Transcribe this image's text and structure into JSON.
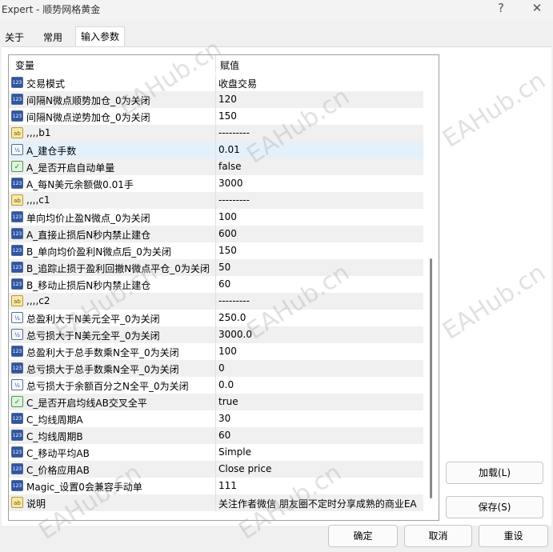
{
  "window": {
    "title": "Expert - 顺势网格黄金",
    "help_label": "?",
    "close_label": "✕"
  },
  "tabs": [
    {
      "label": "关于"
    },
    {
      "label": "常用"
    },
    {
      "label": "输入参数"
    }
  ],
  "grid": {
    "col_name": "变量",
    "col_value": "赋值",
    "rows": [
      {
        "type": "int",
        "name": "交易模式",
        "value": "收盘交易"
      },
      {
        "type": "int",
        "name": "间隔N微点顺势加仓_0为关闭",
        "value": "120"
      },
      {
        "type": "int",
        "name": "间隔N微点逆势加仓_0为关闭",
        "value": "150"
      },
      {
        "type": "ab",
        "name": ",,,,b1",
        "value": "---------"
      },
      {
        "type": "dbl",
        "name": "A_建仓手数",
        "value": "0.01"
      },
      {
        "type": "bool",
        "name": "A_是否开启自动单量",
        "value": "false"
      },
      {
        "type": "int",
        "name": "A_每N美元余额做0.01手",
        "value": "3000"
      },
      {
        "type": "ab",
        "name": ",,,,c1",
        "value": "---------"
      },
      {
        "type": "int",
        "name": "单向均价止盈N微点_0为关闭",
        "value": "100"
      },
      {
        "type": "int",
        "name": "A_直接止损后N秒内禁止建仓",
        "value": "600"
      },
      {
        "type": "int",
        "name": "B_单向均价盈利N微点后_0为关闭",
        "value": "150"
      },
      {
        "type": "int",
        "name": "B_追踪止损于盈利回撤N微点平仓_0为关闭",
        "value": "50"
      },
      {
        "type": "int",
        "name": "B_移动止损后N秒内禁止建仓",
        "value": "60"
      },
      {
        "type": "ab",
        "name": ",,,,c2",
        "value": "---------"
      },
      {
        "type": "dbl",
        "name": "总盈利大于N美元全平_0为关闭",
        "value": "250.0"
      },
      {
        "type": "dbl",
        "name": "总亏损大于N美元全平_0为关闭",
        "value": "3000.0"
      },
      {
        "type": "int",
        "name": "总盈利大于总手数乘N全平_0为关闭",
        "value": "100"
      },
      {
        "type": "int",
        "name": "总亏损大于总手数乘N全平_0为关闭",
        "value": "0"
      },
      {
        "type": "dbl",
        "name": "总亏损大于余额百分之N全平_0为关闭",
        "value": "0.0"
      },
      {
        "type": "bool",
        "name": "C_是否开启均线AB交叉全平",
        "value": "true"
      },
      {
        "type": "int",
        "name": "C_均线周期A",
        "value": "30"
      },
      {
        "type": "int",
        "name": "C_均线周期B",
        "value": "60"
      },
      {
        "type": "int",
        "name": "C_移动平均AB",
        "value": "Simple"
      },
      {
        "type": "int",
        "name": "C_价格应用AB",
        "value": "Close price"
      },
      {
        "type": "int",
        "name": "Magic_设置0会兼容手动单",
        "value": "111"
      },
      {
        "type": "ab",
        "name": "说明",
        "value": "关注作者微信 朋友圈不定时分享成熟的商业EA"
      }
    ]
  },
  "icon_labels": {
    "int": "123",
    "dbl": "½",
    "ab": "ab",
    "bool": "✓"
  },
  "buttons": {
    "load": "加载(L)",
    "save": "保存(S)",
    "ok": "确定",
    "cancel": "取消",
    "reset": "重设"
  },
  "watermark": "EAHub.cn"
}
